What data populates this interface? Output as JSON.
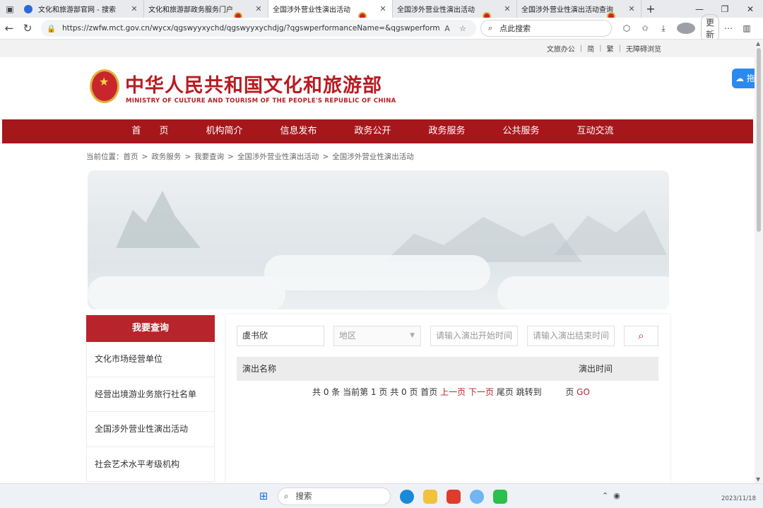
{
  "browser": {
    "tabs": [
      {
        "title": "文化和旅游部官网 - 搜索",
        "favicon": "search"
      },
      {
        "title": "文化和旅游部政务服务门户",
        "favicon": "emblem"
      },
      {
        "title": "全国涉外营业性演出活动",
        "favicon": "emblem",
        "active": true
      },
      {
        "title": "全国涉外营业性演出活动",
        "favicon": "emblem"
      },
      {
        "title": "全国涉外营业性演出活动查询",
        "favicon": "emblem"
      }
    ],
    "url": "https://zwfw.mct.gov.cn/wycx/qgswyyxychd/qgswyyxychdjg/?qgswperformanceName=&qgswperformancePlace1=...",
    "search_placeholder": "点此搜索",
    "update_label": "更新"
  },
  "site": {
    "top_links": [
      "文旅办公",
      "简",
      "繁",
      "无障碍浏览"
    ],
    "logo_cn": "中华人民共和国文化和旅游部",
    "logo_en": "MINISTRY OF CULTURE AND TOURISM OF THE PEOPLE'S REPUBLIC OF CHINA",
    "nav": [
      "首　　页",
      "机构简介",
      "信息发布",
      "政务公开",
      "政务服务",
      "公共服务",
      "互动交流"
    ],
    "breadcrumb": {
      "prefix": "当前位置：",
      "items": [
        "首页",
        "政务服务",
        "我要查询",
        "全国涉外营业性演出活动",
        "全国涉外营业性演出活动"
      ]
    },
    "float_button": "拖"
  },
  "sidebar": {
    "title": "我要查询",
    "items": [
      "文化市场经营单位",
      "经营出境游业务旅行社名单",
      "全国涉外营业性演出活动",
      "社会艺术水平考级机构"
    ]
  },
  "query": {
    "name_value": "虞书欣",
    "region_placeholder": "地区",
    "start_placeholder": "请输入演出开始时间",
    "end_placeholder": "请输入演出结束时间",
    "columns": [
      "演出名称",
      "演出时间"
    ],
    "pager": {
      "total": "共 0 条",
      "current": "当前第  1 页",
      "pages": "共 0 页",
      "first": "首页",
      "prev": "上一页",
      "next": "下一页",
      "last": "尾页",
      "jump": "跳转到",
      "page_unit": "页",
      "go": "GO"
    }
  },
  "taskbar": {
    "search_label": "搜索",
    "clock": "2023/11/18"
  }
}
